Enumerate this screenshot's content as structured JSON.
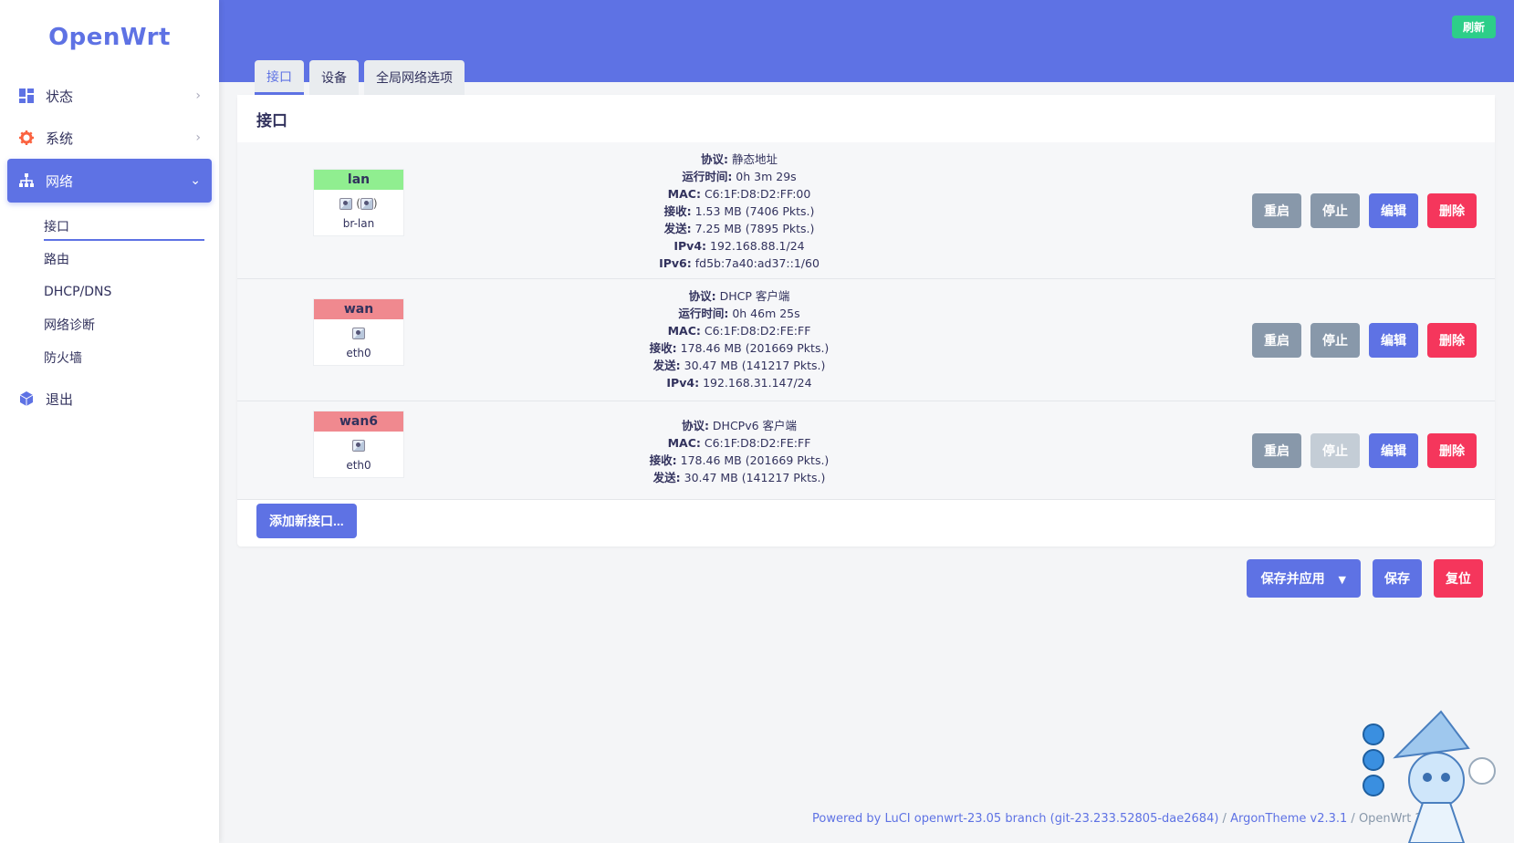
{
  "app": {
    "logo": "OpenWrt",
    "refresh_label": "刷新"
  },
  "sidebar": {
    "items": [
      {
        "label": "状态",
        "icon": "dashboard-icon"
      },
      {
        "label": "系统",
        "icon": "gear-icon"
      },
      {
        "label": "网络",
        "icon": "network-icon",
        "active": true
      },
      {
        "label": "退出",
        "icon": "cube-icon"
      }
    ],
    "submenu": [
      {
        "label": "接口",
        "active": true
      },
      {
        "label": "路由"
      },
      {
        "label": "DHCP/DNS"
      },
      {
        "label": "网络诊断"
      },
      {
        "label": "防火墙"
      }
    ]
  },
  "tabs": [
    {
      "label": "接口",
      "active": true
    },
    {
      "label": "设备"
    },
    {
      "label": "全局网络选项"
    }
  ],
  "panel": {
    "title": "接口"
  },
  "labels": {
    "proto": "协议:",
    "uptime": "运行时间:",
    "mac": "MAC:",
    "rx": "接收:",
    "tx": "发送:",
    "ipv4": "IPv4:",
    "ipv6": "IPv6:",
    "restart": "重启",
    "stop": "停止",
    "edit": "编辑",
    "delete": "删除"
  },
  "interfaces": [
    {
      "name": "lan",
      "device": "br-lan",
      "color": "#90ee90",
      "proto": "静态地址",
      "uptime": "0h 3m 29s",
      "mac": "C6:1F:D8:D2:FF:00",
      "rx": "1.53 MB (7406 Pkts.)",
      "tx": "7.25 MB (7895 Pkts.)",
      "ipv4": "192.168.88.1/24",
      "ipv6": "fd5b:7a40:ad37::1/60"
    },
    {
      "name": "wan",
      "device": "eth0",
      "color": "#f0898f",
      "proto": "DHCP 客户端",
      "uptime": "0h 46m 25s",
      "mac": "C6:1F:D8:D2:FE:FF",
      "rx": "178.46 MB (201669 Pkts.)",
      "tx": "30.47 MB (141217 Pkts.)",
      "ipv4": "192.168.31.147/24"
    },
    {
      "name": "wan6",
      "device": "eth0",
      "color": "#f0898f",
      "proto": "DHCPv6 客户端",
      "mac": "C6:1F:D8:D2:FE:FF",
      "rx": "178.46 MB (201669 Pkts.)",
      "tx": "30.47 MB (141217 Pkts.)",
      "stop_disabled": true
    }
  ],
  "add_interface_label": "添加新接口...",
  "footer_buttons": {
    "apply": "保存并应用",
    "save": "保存",
    "reset": "复位"
  },
  "footer": {
    "luci": "Powered by LuCI openwrt-23.05 branch (git-23.233.52805-dae2684)",
    "sep": " / ",
    "theme": "ArgonTheme v2.3.1",
    "sep2": " / ",
    "os": "OpenWrt 23"
  }
}
